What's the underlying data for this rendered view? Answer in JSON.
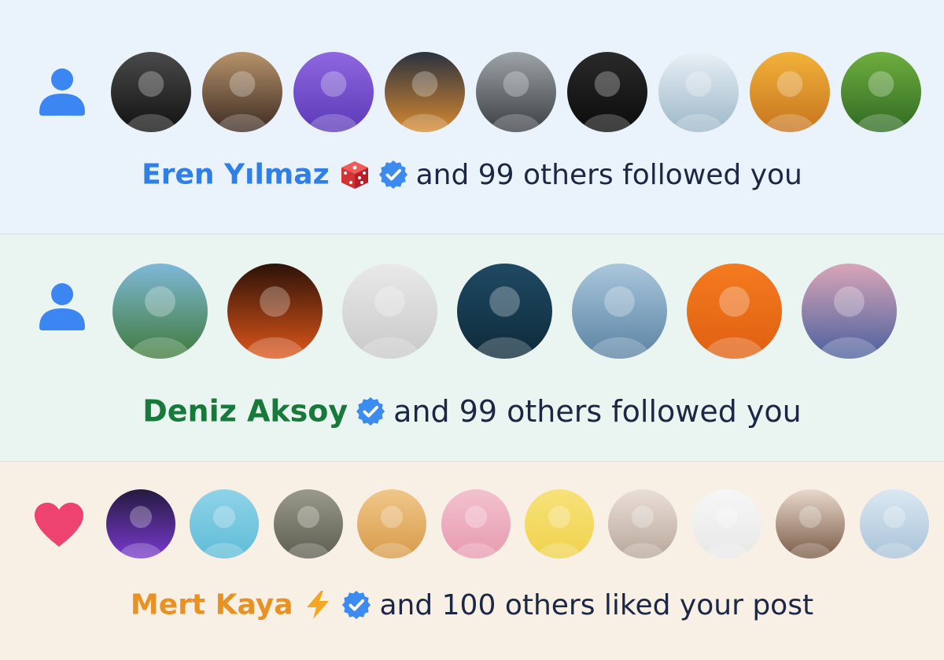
{
  "notifications": [
    {
      "kind": "follow",
      "kind_icon": "person-icon",
      "name": "Eren Yılmaz",
      "name_color": "#2f7fe6",
      "emoji_icon": "dice-icon",
      "verified": true,
      "rest": "and 99 others followed you",
      "background": "#eaf3fb",
      "avatars": [
        {
          "icon": "man-in-fedora-avatar",
          "bg": [
            "#4a4a4a",
            "#111111"
          ]
        },
        {
          "icon": "woman-with-sunglasses-avatar",
          "bg": [
            "#b7936b",
            "#3c2a22"
          ]
        },
        {
          "icon": "purple-robot-avatar",
          "bg": [
            "#8f67e0",
            "#5b39b8"
          ]
        },
        {
          "icon": "rocket-launch-avatar",
          "bg": [
            "#2a3240",
            "#d88a2e"
          ]
        },
        {
          "icon": "dark-knight-avatar",
          "bg": [
            "#9ea3a8",
            "#3b3f44"
          ]
        },
        {
          "icon": "man-with-bitcoin-cap-avatar",
          "bg": [
            "#2a2a2a",
            "#0b0b0b"
          ]
        },
        {
          "icon": "man-at-window-avatar",
          "bg": [
            "#e9f0f6",
            "#9cb7c8"
          ]
        },
        {
          "icon": "anime-boy-avatar",
          "bg": [
            "#f2b23a",
            "#c7741e"
          ]
        },
        {
          "icon": "green-leaf-avatar",
          "bg": [
            "#6fae3f",
            "#2f6a22"
          ]
        }
      ]
    },
    {
      "kind": "follow",
      "kind_icon": "person-icon",
      "name": "Deniz Aksoy",
      "name_color": "#177a3b",
      "emoji_icon": "",
      "verified": true,
      "rest": "and 99 others followed you",
      "background": "#eaf4f0",
      "avatars": [
        {
          "icon": "man-with-yellow-hat-avatar",
          "bg": [
            "#7fb8d8",
            "#3f7a3a"
          ]
        },
        {
          "icon": "man-with-flames-avatar",
          "bg": [
            "#2b1208",
            "#e0561a"
          ]
        },
        {
          "icon": "cartoon-monkey-avatar",
          "bg": [
            "#e9e9e9",
            "#c9c9c9"
          ]
        },
        {
          "icon": "smiling-man-avatar",
          "bg": [
            "#1f4a63",
            "#0e2a3a"
          ]
        },
        {
          "icon": "cowboy-avatar",
          "bg": [
            "#a9c7dc",
            "#5b83a3"
          ]
        },
        {
          "icon": "pirate-cat-avatar",
          "bg": [
            "#f47a1f",
            "#e06012"
          ]
        },
        {
          "icon": "sailboat-avatar",
          "bg": [
            "#d9a6b8",
            "#4a5f9e"
          ]
        }
      ]
    },
    {
      "kind": "like",
      "kind_icon": "heart-icon",
      "name": "Mert Kaya",
      "name_color": "#e99223",
      "emoji_icon": "lightning-icon",
      "verified": true,
      "rest": "and 100 others liked your post",
      "background": "#f8efe5",
      "avatars": [
        {
          "icon": "wizard-avatar",
          "bg": [
            "#241a3f",
            "#7a3ad0"
          ]
        },
        {
          "icon": "bandaged-rabbit-avatar",
          "bg": [
            "#8ed3e8",
            "#5fbcd7"
          ]
        },
        {
          "icon": "white-dog-avatar",
          "bg": [
            "#9a9a8a",
            "#5d5d50"
          ]
        },
        {
          "icon": "cat-with-sunglasses-avatar",
          "bg": [
            "#f0c78a",
            "#d79b4a"
          ]
        },
        {
          "icon": "cartoon-boy-avatar",
          "bg": [
            "#f3c2cf",
            "#e79ab0"
          ]
        },
        {
          "icon": "pixel-punk-avatar",
          "bg": [
            "#f7e27a",
            "#f0d24c"
          ]
        },
        {
          "icon": "woman-in-white-avatar",
          "bg": [
            "#eadfd8",
            "#b8a79a"
          ]
        },
        {
          "icon": "pink-bunny-avatar",
          "bg": [
            "#f6f6f6",
            "#e8e8e8"
          ]
        },
        {
          "icon": "young-woman-avatar",
          "bg": [
            "#e8d9cc",
            "#7a5a46"
          ]
        },
        {
          "icon": "blue-hair-man-avatar",
          "bg": [
            "#dbe8f2",
            "#a8c3d8"
          ]
        }
      ]
    }
  ],
  "colors": {
    "follow_icon": "#3b86f2",
    "like_icon": "#ee4370",
    "verified_badge": "#3b8bf0",
    "text": "#1c2746"
  }
}
